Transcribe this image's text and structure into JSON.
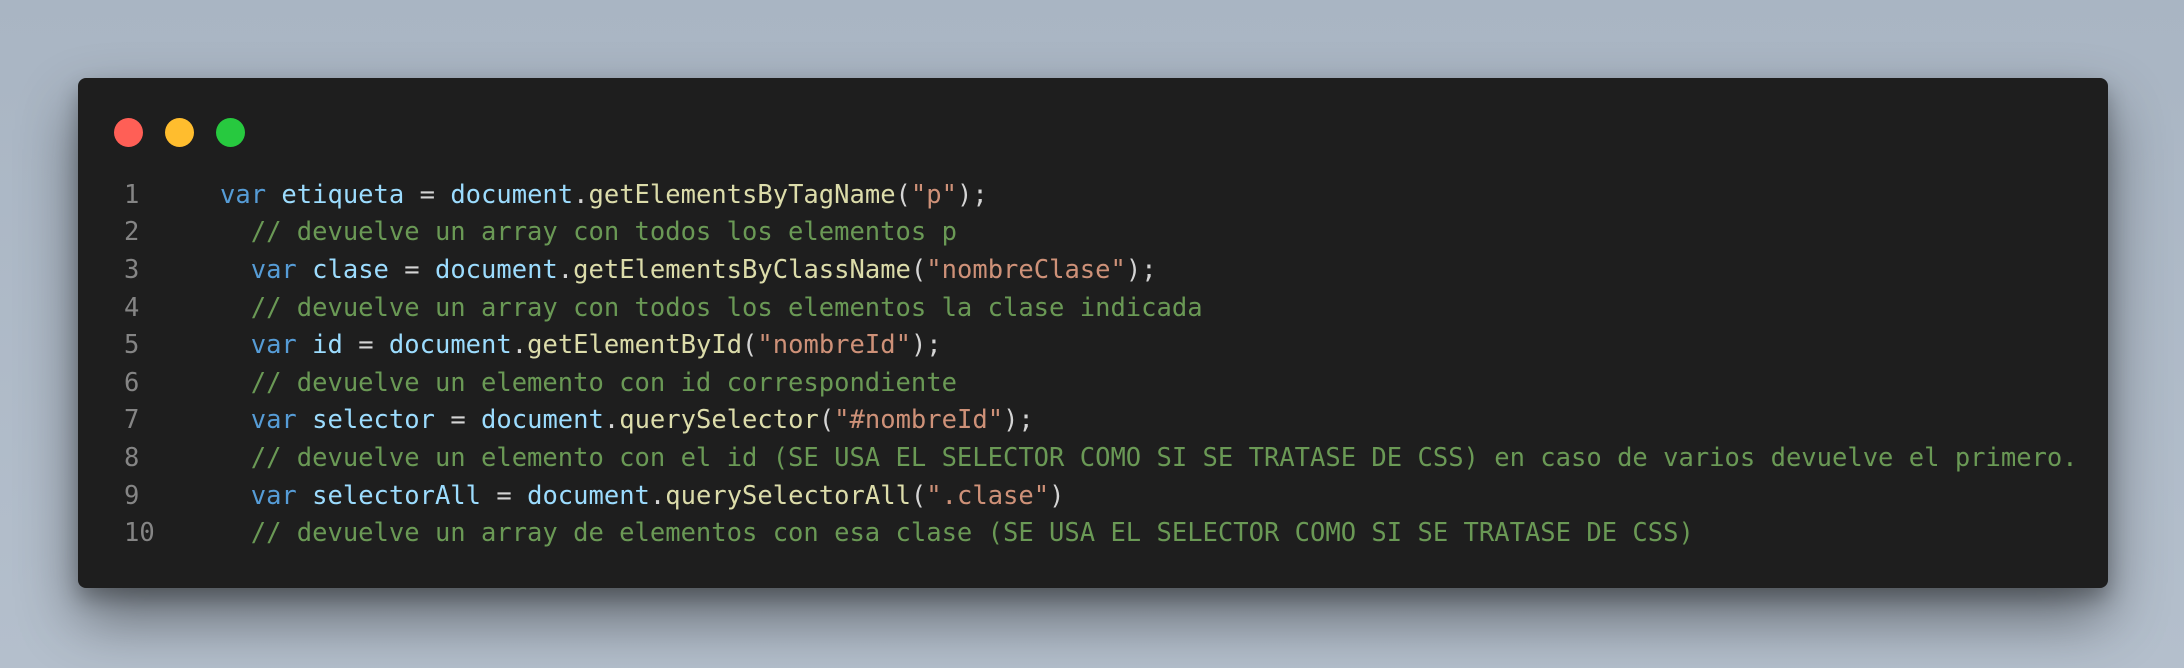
{
  "window": {
    "controls": [
      "close",
      "minimize",
      "maximize"
    ]
  },
  "lines": [
    {
      "number": "1",
      "indent": "",
      "tokens": [
        {
          "text": "var",
          "type": "kw"
        },
        {
          "text": " ",
          "type": "op"
        },
        {
          "text": "etiqueta",
          "type": "var"
        },
        {
          "text": " = ",
          "type": "op"
        },
        {
          "text": "document",
          "type": "var"
        },
        {
          "text": ".",
          "type": "op"
        },
        {
          "text": "getElementsByTagName",
          "type": "fn"
        },
        {
          "text": "(",
          "type": "op"
        },
        {
          "text": "\"p\"",
          "type": "str"
        },
        {
          "text": ");",
          "type": "op"
        }
      ]
    },
    {
      "number": "2",
      "indent": "  ",
      "tokens": [
        {
          "text": "// devuelve un array con todos los elementos p",
          "type": "cm"
        }
      ]
    },
    {
      "number": "3",
      "indent": "  ",
      "tokens": [
        {
          "text": "var",
          "type": "kw"
        },
        {
          "text": " ",
          "type": "op"
        },
        {
          "text": "clase",
          "type": "var"
        },
        {
          "text": " = ",
          "type": "op"
        },
        {
          "text": "document",
          "type": "var"
        },
        {
          "text": ".",
          "type": "op"
        },
        {
          "text": "getElementsByClassName",
          "type": "fn"
        },
        {
          "text": "(",
          "type": "op"
        },
        {
          "text": "\"nombreClase\"",
          "type": "str"
        },
        {
          "text": ");",
          "type": "op"
        }
      ]
    },
    {
      "number": "4",
      "indent": "  ",
      "tokens": [
        {
          "text": "// devuelve un array con todos los elementos la clase indicada",
          "type": "cm"
        }
      ]
    },
    {
      "number": "5",
      "indent": "  ",
      "tokens": [
        {
          "text": "var",
          "type": "kw"
        },
        {
          "text": " ",
          "type": "op"
        },
        {
          "text": "id",
          "type": "var"
        },
        {
          "text": " = ",
          "type": "op"
        },
        {
          "text": "document",
          "type": "var"
        },
        {
          "text": ".",
          "type": "op"
        },
        {
          "text": "getElementById",
          "type": "fn"
        },
        {
          "text": "(",
          "type": "op"
        },
        {
          "text": "\"nombreId\"",
          "type": "str"
        },
        {
          "text": ");",
          "type": "op"
        }
      ]
    },
    {
      "number": "6",
      "indent": "  ",
      "tokens": [
        {
          "text": "// devuelve un elemento con id correspondiente",
          "type": "cm"
        }
      ]
    },
    {
      "number": "7",
      "indent": "  ",
      "tokens": [
        {
          "text": "var",
          "type": "kw"
        },
        {
          "text": " ",
          "type": "op"
        },
        {
          "text": "selector",
          "type": "var"
        },
        {
          "text": " = ",
          "type": "op"
        },
        {
          "text": "document",
          "type": "var"
        },
        {
          "text": ".",
          "type": "op"
        },
        {
          "text": "querySelector",
          "type": "fn"
        },
        {
          "text": "(",
          "type": "op"
        },
        {
          "text": "\"#nombreId\"",
          "type": "str"
        },
        {
          "text": ");",
          "type": "op"
        }
      ]
    },
    {
      "number": "8",
      "indent": "  ",
      "tokens": [
        {
          "text": "// devuelve un elemento con el id (SE USA EL SELECTOR COMO SI SE TRATASE DE CSS) en caso de varios devuelve el primero.",
          "type": "cm"
        }
      ]
    },
    {
      "number": "9",
      "indent": "  ",
      "tokens": [
        {
          "text": "var",
          "type": "kw"
        },
        {
          "text": " ",
          "type": "op"
        },
        {
          "text": "selectorAll",
          "type": "var"
        },
        {
          "text": " = ",
          "type": "op"
        },
        {
          "text": "document",
          "type": "var"
        },
        {
          "text": ".",
          "type": "op"
        },
        {
          "text": "querySelectorAll",
          "type": "fn"
        },
        {
          "text": "(",
          "type": "op"
        },
        {
          "text": "\".clase\"",
          "type": "str"
        },
        {
          "text": ")",
          "type": "op"
        }
      ]
    },
    {
      "number": "10",
      "indent": "  ",
      "tokens": [
        {
          "text": "// devuelve un array de elementos con esa clase (SE USA EL SELECTOR COMO SI SE TRATASE DE CSS)",
          "type": "cm"
        }
      ]
    }
  ],
  "colors": {
    "background": "#1e1e1e",
    "keyword": "#569cd6",
    "variable": "#9cdcfe",
    "function": "#dcdcaa",
    "string": "#ce9178",
    "comment": "#6a9955",
    "line_number": "#858585",
    "close": "#ff5f56",
    "minimize": "#ffbd2e",
    "maximize": "#27c93f"
  }
}
